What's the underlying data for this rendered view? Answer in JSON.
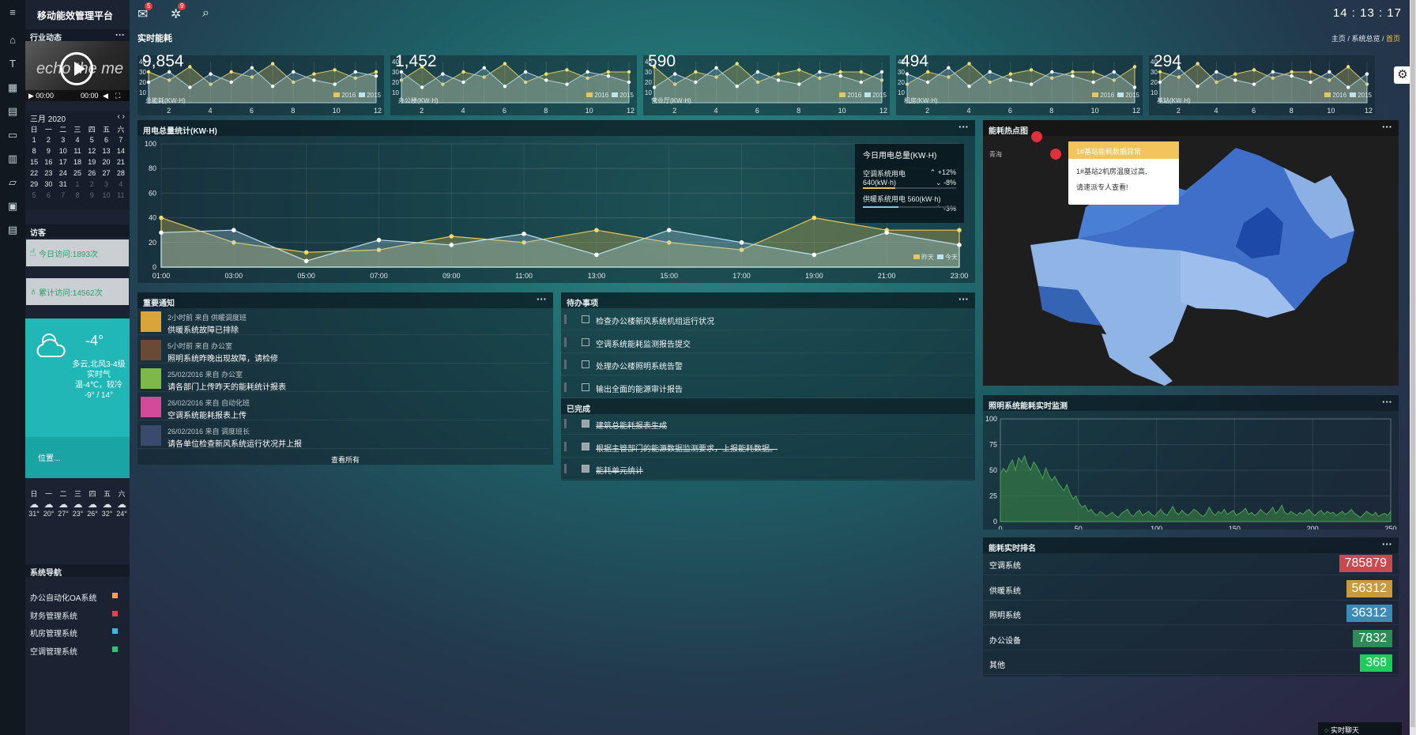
{
  "app": {
    "title": "移动能效管理平台",
    "clock": "14 : 13 : 17",
    "mail_badge": "5",
    "task_badge": "9"
  },
  "icons": {
    "menu": "hamburger-icon",
    "mail": "envelope-icon",
    "tasks": "network-icon",
    "search": "search-icon"
  },
  "sidebar": {
    "industry_title": "行业动态",
    "video": {
      "text": "echo the me",
      "time_left": "00:00",
      "time_right": "00:00"
    },
    "calendar": {
      "month": "三月 2020",
      "weekdays": [
        "日",
        "一",
        "二",
        "三",
        "四",
        "五",
        "六"
      ],
      "weeks": [
        [
          "1",
          "2",
          "3",
          "4",
          "5",
          "6",
          "7"
        ],
        [
          "8",
          "9",
          "10",
          "11",
          "12",
          "13",
          "14"
        ],
        [
          "15",
          "16",
          "17",
          "18",
          "19",
          "20",
          "21"
        ],
        [
          "22",
          "23",
          "24",
          "25",
          "26",
          "27",
          "28"
        ],
        [
          "29",
          "30",
          "31",
          "1",
          "2",
          "3",
          "4"
        ],
        [
          "5",
          "6",
          "7",
          "8",
          "9",
          "10",
          "11"
        ]
      ]
    },
    "visits_title": "访客",
    "today_visits": "今日访问:1893次",
    "total_visits": "累计访问:14562次",
    "weather": {
      "temp": "-4°",
      "desc": "多云,北风3-4级",
      "real": "实时气温-4℃，较冷",
      "range": "-9° / 14°",
      "location": "位置..."
    },
    "forecast": {
      "days": [
        "日",
        "一",
        "二",
        "三",
        "四",
        "五",
        "六"
      ],
      "temps": [
        "31°",
        "20°",
        "27°",
        "23°",
        "26°",
        "32°",
        "24°"
      ]
    },
    "nav_title": "系统导航",
    "nav_items": [
      {
        "label": "办公自动化OA系统",
        "color": "#f0a35e"
      },
      {
        "label": "财务管理系统",
        "color": "#e0434f"
      },
      {
        "label": "机房管理系统",
        "color": "#3bbbd9"
      },
      {
        "label": "空调管理系统",
        "color": "#2fc27a"
      }
    ]
  },
  "main": {
    "section_title": "实时能耗",
    "breadcrumb": [
      "主页",
      "系统总览",
      "首页"
    ],
    "kpis": [
      {
        "value": "9,854",
        "label": "总能耗(KW·H)"
      },
      {
        "value": "1,452",
        "label": "办公楼(KW·H)"
      },
      {
        "value": "590",
        "label": "营业厅(KW·H)"
      },
      {
        "value": "494",
        "label": "机房(KW·H)"
      },
      {
        "value": "294",
        "label": "基站(KW·H)"
      }
    ],
    "kpi_legend": [
      "2016",
      "2015"
    ],
    "usage_panel": {
      "title": "用电总量统计(KW·H)",
      "legend": [
        "昨天",
        "今天"
      ],
      "today_box": {
        "title": "今日用电总量(KW·H)",
        "items": [
          {
            "name": "空调系统用电",
            "value": "640(kW·h)",
            "change": "+12%",
            "dir": "up",
            "pct": 0.35,
            "color": "#f0c04a"
          },
          {
            "name": "",
            "value": "",
            "change": "-8%",
            "dir": "down",
            "pct": 0,
            "color": "#f0c04a"
          },
          {
            "name": "供暖系统用电 560(kW·h)",
            "value": "",
            "change": "-3%",
            "dir": "up",
            "pct": 0.38,
            "color": "#7cc8e8"
          }
        ]
      }
    },
    "notice_panel": {
      "title": "重要通知",
      "view_all": "查看所有",
      "items": [
        {
          "meta": "2小时前 来自 供暖调度班",
          "msg": "供暖系统故障已排除",
          "avatar": "#d9a43a"
        },
        {
          "meta": "5小时前 来自 办公室",
          "msg": "照明系统昨晚出现故障，请检修",
          "avatar": "#6a4a35"
        },
        {
          "meta": "25/02/2016 来自 办公室",
          "msg": "请各部门上传昨天的能耗统计报表",
          "avatar": "#7cb84a"
        },
        {
          "meta": "26/02/2016 来自 自动化班",
          "msg": "空调系统能耗报表上传",
          "avatar": "#d44a9a"
        },
        {
          "meta": "26/02/2016 来自 调度班长",
          "msg": "请各单位检查新风系统运行状况并上报",
          "avatar": "#3a4a6a"
        }
      ]
    },
    "todo_panel": {
      "title": "待办事项",
      "done_title": "已完成",
      "todo": [
        "检查办公楼新风系统机组运行状况",
        "空调系统能耗监测报告提交",
        "处理办公楼照明系统告警",
        "输出全面的能源审计报告"
      ],
      "done": [
        "建筑总能耗报表生成",
        "根据主管部门的能源数据监测要求，上报能耗数据。",
        "能耗单元统计"
      ]
    },
    "map_panel": {
      "title": "能耗热点图",
      "region": "青海",
      "popup_title": "1#基站能耗数据异常",
      "popup_body": [
        "1#基站2机房温度过高,",
        "请速派专人查看!"
      ]
    },
    "lighting_panel": {
      "title": "照明系统能耗实时监测"
    },
    "rank_panel": {
      "title": "能耗实时排名",
      "items": [
        {
          "name": "空调系统",
          "value": "785879",
          "color": "#c84a4e"
        },
        {
          "name": "供暖系统",
          "value": "56312",
          "color": "#c89a3e"
        },
        {
          "name": "照明系统",
          "value": "36312",
          "color": "#3c8ab8"
        },
        {
          "name": "办公设备",
          "value": "7832",
          "color": "#2f8a58"
        },
        {
          "name": "其他",
          "value": "368",
          "color": "#1ecc5a"
        }
      ]
    },
    "chat_label": "实时聊天"
  },
  "chart_data": [
    {
      "type": "line",
      "id": "usage",
      "x": [
        "01:00",
        "03:00",
        "05:00",
        "07:00",
        "09:00",
        "11:00",
        "13:00",
        "15:00",
        "17:00",
        "19:00",
        "21:00",
        "23:00"
      ],
      "ylim": [
        0,
        100
      ],
      "yticks": [
        0,
        20,
        40,
        60,
        80,
        100
      ],
      "series": [
        {
          "name": "昨天",
          "values": [
            40,
            20,
            12,
            14,
            25,
            20,
            30,
            20,
            14,
            40,
            30,
            30
          ],
          "color": "#e8c65a"
        },
        {
          "name": "今天",
          "values": [
            28,
            30,
            5,
            22,
            18,
            27,
            10,
            30,
            20,
            10,
            28,
            18
          ],
          "color": "#bde2f0"
        }
      ]
    },
    {
      "type": "area",
      "id": "lighting",
      "xlim": [
        0,
        250
      ],
      "xticks": [
        0,
        50,
        100,
        150,
        200,
        250
      ],
      "ylim": [
        0,
        100
      ],
      "yticks": [
        0,
        25,
        50,
        75,
        100
      ],
      "values": [
        46,
        52,
        48,
        55,
        60,
        50,
        62,
        58,
        64,
        55,
        50,
        58,
        54,
        48,
        42,
        52,
        45,
        40,
        44,
        38,
        34,
        30,
        36,
        28,
        22,
        25,
        18,
        14,
        16,
        10,
        12,
        8,
        6,
        10,
        8,
        5,
        7,
        9,
        6,
        4,
        8,
        10,
        12,
        7,
        5,
        9,
        11,
        6,
        8,
        10,
        7,
        5,
        9,
        12,
        8,
        6,
        10,
        15,
        9,
        7,
        11,
        8,
        6,
        9,
        12,
        10,
        7,
        5,
        8,
        14,
        9,
        6,
        10,
        8,
        12,
        7,
        9,
        11,
        6,
        8,
        10,
        13,
        7,
        9,
        6,
        8,
        12,
        9,
        7,
        10,
        14,
        8,
        11,
        16,
        9,
        7,
        10,
        8,
        6,
        9,
        7,
        10,
        12,
        8,
        6,
        9,
        11,
        7,
        10,
        8,
        9,
        6,
        8,
        10,
        7,
        9,
        12,
        8,
        6,
        4,
        7,
        10,
        8,
        6,
        9,
        5,
        7,
        8,
        6,
        10
      ]
    },
    {
      "type": "line",
      "id": "kpi",
      "x": [
        2,
        4,
        6,
        8,
        10,
        12
      ],
      "ylim": [
        0,
        40
      ],
      "yticks": [
        10,
        20,
        30,
        40
      ],
      "series_names": [
        "2016",
        "2015"
      ]
    }
  ]
}
